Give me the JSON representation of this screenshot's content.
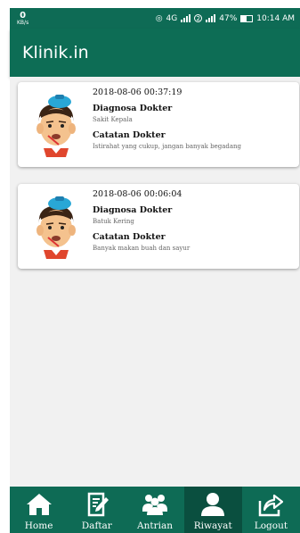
{
  "status_bar": {
    "kbs_value": "0",
    "kbs_unit": "KB/s",
    "network": "4G",
    "sim_slot": "2",
    "battery": "47%",
    "time": "10:14 AM"
  },
  "app_bar": {
    "title": "Klinik.in"
  },
  "history": [
    {
      "datetime": "2018-08-06 00:37:19",
      "diagnosis_label": "Diagnosa Dokter",
      "diagnosis": "Sakit Kepala",
      "notes_label": "Catatan Dokter",
      "notes": "Istirahat yang cukup, jangan banyak begadang"
    },
    {
      "datetime": "2018-08-06 00:06:04",
      "diagnosis_label": "Diagnosa Dokter",
      "diagnosis": "Batuk Kering",
      "notes_label": "Catatan Dokter",
      "notes": "Banyak makan buah dan sayur"
    }
  ],
  "bottom_nav": [
    {
      "label": "Home",
      "icon": "home-icon"
    },
    {
      "label": "Daftar",
      "icon": "clipboard-edit-icon"
    },
    {
      "label": "Antrian",
      "icon": "group-icon"
    },
    {
      "label": "Riwayat",
      "icon": "person-icon",
      "active": true
    },
    {
      "label": "Logout",
      "icon": "share-icon"
    }
  ],
  "colors": {
    "primary": "#0e6b55",
    "nav_active": "#0a4f3f",
    "background": "#f1f1f1"
  }
}
